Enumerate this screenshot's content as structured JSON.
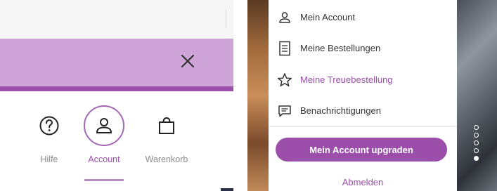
{
  "left_panel": {
    "nav": [
      {
        "label": "Hilfe",
        "icon": "help-circle-icon",
        "active": false
      },
      {
        "label": "Account",
        "icon": "user-icon",
        "active": true
      },
      {
        "label": "Warenkorb",
        "icon": "shopping-bag-icon",
        "active": false
      }
    ],
    "close_icon": "close-icon"
  },
  "right_panel": {
    "menu_items": [
      {
        "label": "Mein Account",
        "icon": "user-icon"
      },
      {
        "label": "Meine Bestellungen",
        "icon": "document-icon"
      },
      {
        "label": "Meine Treuebestellung",
        "icon": "star-icon"
      },
      {
        "label": "Benachrichtigungen",
        "icon": "message-icon"
      }
    ],
    "upgrade_button": "Mein Account upgraden",
    "logout_link": "Abmelden",
    "carousel": {
      "count": 5,
      "active_index": 4
    }
  },
  "colors": {
    "accent": "#9b4eaa",
    "banner": "#cfa5d9",
    "text": "#333333",
    "muted": "#8a8a8a"
  }
}
